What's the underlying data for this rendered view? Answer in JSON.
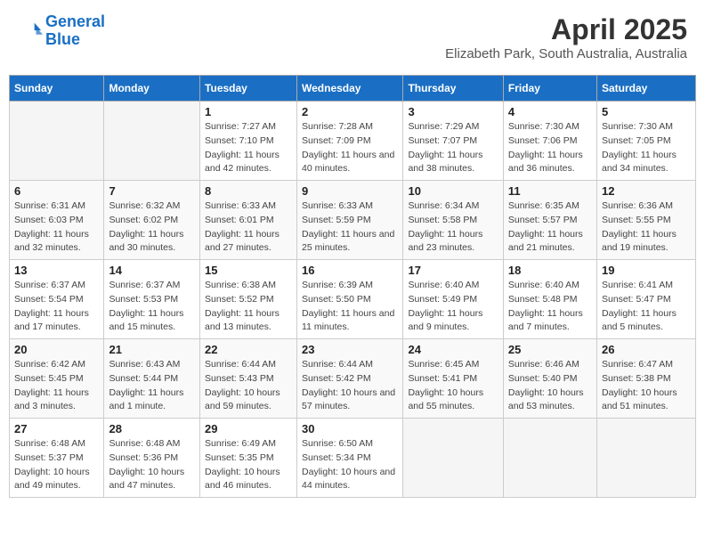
{
  "header": {
    "logo_line1": "General",
    "logo_line2": "Blue",
    "title": "April 2025",
    "subtitle": "Elizabeth Park, South Australia, Australia"
  },
  "days_of_week": [
    "Sunday",
    "Monday",
    "Tuesday",
    "Wednesday",
    "Thursday",
    "Friday",
    "Saturday"
  ],
  "weeks": [
    [
      null,
      null,
      {
        "day": 1,
        "sunrise": "Sunrise: 7:27 AM",
        "sunset": "Sunset: 7:10 PM",
        "daylight": "Daylight: 11 hours and 42 minutes."
      },
      {
        "day": 2,
        "sunrise": "Sunrise: 7:28 AM",
        "sunset": "Sunset: 7:09 PM",
        "daylight": "Daylight: 11 hours and 40 minutes."
      },
      {
        "day": 3,
        "sunrise": "Sunrise: 7:29 AM",
        "sunset": "Sunset: 7:07 PM",
        "daylight": "Daylight: 11 hours and 38 minutes."
      },
      {
        "day": 4,
        "sunrise": "Sunrise: 7:30 AM",
        "sunset": "Sunset: 7:06 PM",
        "daylight": "Daylight: 11 hours and 36 minutes."
      },
      {
        "day": 5,
        "sunrise": "Sunrise: 7:30 AM",
        "sunset": "Sunset: 7:05 PM",
        "daylight": "Daylight: 11 hours and 34 minutes."
      }
    ],
    [
      {
        "day": 6,
        "sunrise": "Sunrise: 6:31 AM",
        "sunset": "Sunset: 6:03 PM",
        "daylight": "Daylight: 11 hours and 32 minutes."
      },
      {
        "day": 7,
        "sunrise": "Sunrise: 6:32 AM",
        "sunset": "Sunset: 6:02 PM",
        "daylight": "Daylight: 11 hours and 30 minutes."
      },
      {
        "day": 8,
        "sunrise": "Sunrise: 6:33 AM",
        "sunset": "Sunset: 6:01 PM",
        "daylight": "Daylight: 11 hours and 27 minutes."
      },
      {
        "day": 9,
        "sunrise": "Sunrise: 6:33 AM",
        "sunset": "Sunset: 5:59 PM",
        "daylight": "Daylight: 11 hours and 25 minutes."
      },
      {
        "day": 10,
        "sunrise": "Sunrise: 6:34 AM",
        "sunset": "Sunset: 5:58 PM",
        "daylight": "Daylight: 11 hours and 23 minutes."
      },
      {
        "day": 11,
        "sunrise": "Sunrise: 6:35 AM",
        "sunset": "Sunset: 5:57 PM",
        "daylight": "Daylight: 11 hours and 21 minutes."
      },
      {
        "day": 12,
        "sunrise": "Sunrise: 6:36 AM",
        "sunset": "Sunset: 5:55 PM",
        "daylight": "Daylight: 11 hours and 19 minutes."
      }
    ],
    [
      {
        "day": 13,
        "sunrise": "Sunrise: 6:37 AM",
        "sunset": "Sunset: 5:54 PM",
        "daylight": "Daylight: 11 hours and 17 minutes."
      },
      {
        "day": 14,
        "sunrise": "Sunrise: 6:37 AM",
        "sunset": "Sunset: 5:53 PM",
        "daylight": "Daylight: 11 hours and 15 minutes."
      },
      {
        "day": 15,
        "sunrise": "Sunrise: 6:38 AM",
        "sunset": "Sunset: 5:52 PM",
        "daylight": "Daylight: 11 hours and 13 minutes."
      },
      {
        "day": 16,
        "sunrise": "Sunrise: 6:39 AM",
        "sunset": "Sunset: 5:50 PM",
        "daylight": "Daylight: 11 hours and 11 minutes."
      },
      {
        "day": 17,
        "sunrise": "Sunrise: 6:40 AM",
        "sunset": "Sunset: 5:49 PM",
        "daylight": "Daylight: 11 hours and 9 minutes."
      },
      {
        "day": 18,
        "sunrise": "Sunrise: 6:40 AM",
        "sunset": "Sunset: 5:48 PM",
        "daylight": "Daylight: 11 hours and 7 minutes."
      },
      {
        "day": 19,
        "sunrise": "Sunrise: 6:41 AM",
        "sunset": "Sunset: 5:47 PM",
        "daylight": "Daylight: 11 hours and 5 minutes."
      }
    ],
    [
      {
        "day": 20,
        "sunrise": "Sunrise: 6:42 AM",
        "sunset": "Sunset: 5:45 PM",
        "daylight": "Daylight: 11 hours and 3 minutes."
      },
      {
        "day": 21,
        "sunrise": "Sunrise: 6:43 AM",
        "sunset": "Sunset: 5:44 PM",
        "daylight": "Daylight: 11 hours and 1 minute."
      },
      {
        "day": 22,
        "sunrise": "Sunrise: 6:44 AM",
        "sunset": "Sunset: 5:43 PM",
        "daylight": "Daylight: 10 hours and 59 minutes."
      },
      {
        "day": 23,
        "sunrise": "Sunrise: 6:44 AM",
        "sunset": "Sunset: 5:42 PM",
        "daylight": "Daylight: 10 hours and 57 minutes."
      },
      {
        "day": 24,
        "sunrise": "Sunrise: 6:45 AM",
        "sunset": "Sunset: 5:41 PM",
        "daylight": "Daylight: 10 hours and 55 minutes."
      },
      {
        "day": 25,
        "sunrise": "Sunrise: 6:46 AM",
        "sunset": "Sunset: 5:40 PM",
        "daylight": "Daylight: 10 hours and 53 minutes."
      },
      {
        "day": 26,
        "sunrise": "Sunrise: 6:47 AM",
        "sunset": "Sunset: 5:38 PM",
        "daylight": "Daylight: 10 hours and 51 minutes."
      }
    ],
    [
      {
        "day": 27,
        "sunrise": "Sunrise: 6:48 AM",
        "sunset": "Sunset: 5:37 PM",
        "daylight": "Daylight: 10 hours and 49 minutes."
      },
      {
        "day": 28,
        "sunrise": "Sunrise: 6:48 AM",
        "sunset": "Sunset: 5:36 PM",
        "daylight": "Daylight: 10 hours and 47 minutes."
      },
      {
        "day": 29,
        "sunrise": "Sunrise: 6:49 AM",
        "sunset": "Sunset: 5:35 PM",
        "daylight": "Daylight: 10 hours and 46 minutes."
      },
      {
        "day": 30,
        "sunrise": "Sunrise: 6:50 AM",
        "sunset": "Sunset: 5:34 PM",
        "daylight": "Daylight: 10 hours and 44 minutes."
      },
      null,
      null,
      null
    ]
  ]
}
